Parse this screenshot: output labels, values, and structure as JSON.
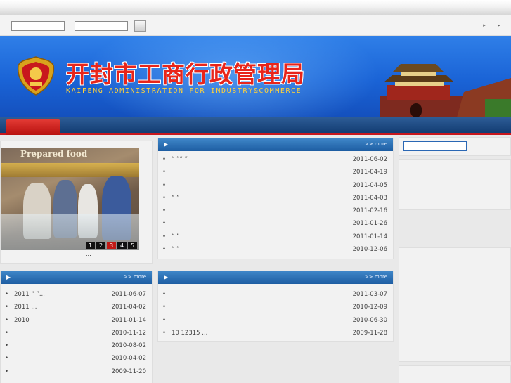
{
  "toolbar": {
    "input1_value": "",
    "input2_value": "",
    "arrows": [
      "▸",
      "▸"
    ]
  },
  "banner": {
    "title": "开封市工商行政管理局",
    "subtitle": "KAIFENG ADMINISTRATION FOR INDUSTRY&COMMERCE"
  },
  "photo": {
    "sign": "Prepared food",
    "pager": [
      "1",
      "2",
      "3",
      "4",
      "5"
    ],
    "active_page": 3,
    "caption": "..."
  },
  "news_center": {
    "more": ">> more",
    "items": [
      {
        "title": "“ ”“ ”",
        "date": "2011-06-02"
      },
      {
        "title": "",
        "date": "2011-04-19"
      },
      {
        "title": "",
        "date": "2011-04-05"
      },
      {
        "title": "“      ”",
        "date": "2011-04-03"
      },
      {
        "title": "",
        "date": "2011-02-16"
      },
      {
        "title": "",
        "date": "2011-01-26"
      },
      {
        "title": "      “ ”",
        "date": "2011-01-14"
      },
      {
        "title": "“ ”",
        "date": "2010-12-06"
      }
    ]
  },
  "news_left": {
    "more": ">> more",
    "items": [
      {
        "title": "2011 “      ”...",
        "date": "2011-06-07"
      },
      {
        "title": "  2011          ...",
        "date": "2011-04-02"
      },
      {
        "title": "2010",
        "date": "2011-01-14"
      },
      {
        "title": "",
        "date": "2010-11-12"
      },
      {
        "title": "",
        "date": "2010-08-02"
      },
      {
        "title": "",
        "date": "2010-04-02"
      },
      {
        "title": "",
        "date": "2009-11-20"
      }
    ]
  },
  "news_mid": {
    "more": ">> more",
    "items": [
      {
        "title": "",
        "date": "2011-03-07"
      },
      {
        "title": "",
        "date": "2010-12-09"
      },
      {
        "title": "",
        "date": "2010-06-30"
      },
      {
        "title": "       10    12315    ...",
        "date": "2009-11-28"
      }
    ]
  },
  "right": {
    "search_value": ""
  }
}
